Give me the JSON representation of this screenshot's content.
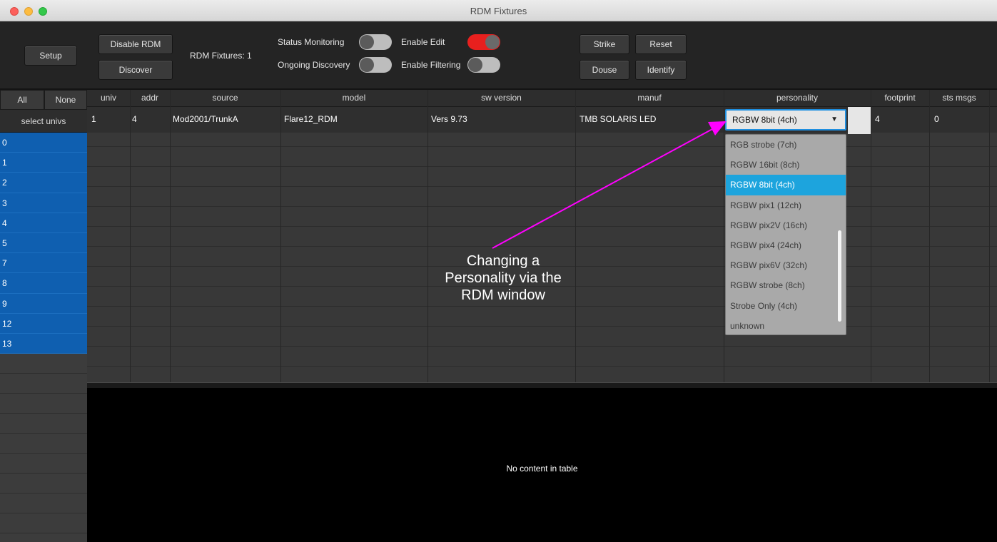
{
  "window": {
    "title": "RDM Fixtures"
  },
  "toolbar": {
    "setup": "Setup",
    "disable_rdm": "Disable RDM",
    "discover": "Discover",
    "fixture_count": "RDM Fixtures: 1",
    "status_monitoring": {
      "label": "Status Monitoring",
      "state": "off"
    },
    "ongoing_discovery": {
      "label": "Ongoing Discovery",
      "state": "off"
    },
    "enable_edit": {
      "label": "Enable Edit",
      "state": "on"
    },
    "enable_filtering": {
      "label": "Enable Filtering",
      "state": "off"
    },
    "strike": "Strike",
    "reset": "Reset",
    "douse": "Douse",
    "identify": "Identify",
    "toggle_on_color": "#e8201e"
  },
  "left_panel": {
    "all": "All",
    "none": "None",
    "header": "select univs",
    "universes": [
      "0",
      "1",
      "2",
      "3",
      "4",
      "5",
      "7",
      "8",
      "9",
      "12",
      "13"
    ]
  },
  "table": {
    "columns": [
      "univ",
      "addr",
      "source",
      "model",
      "sw version",
      "manuf",
      "personality",
      "footprint",
      "sts msgs"
    ],
    "rows": [
      {
        "univ": "1",
        "addr": "4",
        "source": "Mod2001/TrunkA",
        "model": "Flare12_RDM",
        "sw_version": "Vers 9.73",
        "manuf": "TMB SOLARIS LED",
        "personality": "RGBW 8bit (4ch)",
        "footprint": "4",
        "sts_msgs": "0"
      }
    ]
  },
  "personality_dropdown": {
    "options": [
      "RGB strobe (7ch)",
      "RGBW 16bit (8ch)",
      "RGBW 8bit (4ch)",
      "RGBW pix1 (12ch)",
      "RGBW pix2V (16ch)",
      "RGBW pix4 (24ch)",
      "RGBW pix6V (32ch)",
      "RGBW strobe (8ch)",
      "Strobe Only (4ch)",
      "unknown"
    ],
    "selected": "RGBW 8bit (4ch)",
    "highlight_color": "#1da4dd"
  },
  "bottom_table": {
    "empty_text": "No content in table"
  },
  "annotation": {
    "lines": [
      "Changing a",
      "Personality via the",
      "RDM window"
    ],
    "color": "#ff00ff"
  }
}
